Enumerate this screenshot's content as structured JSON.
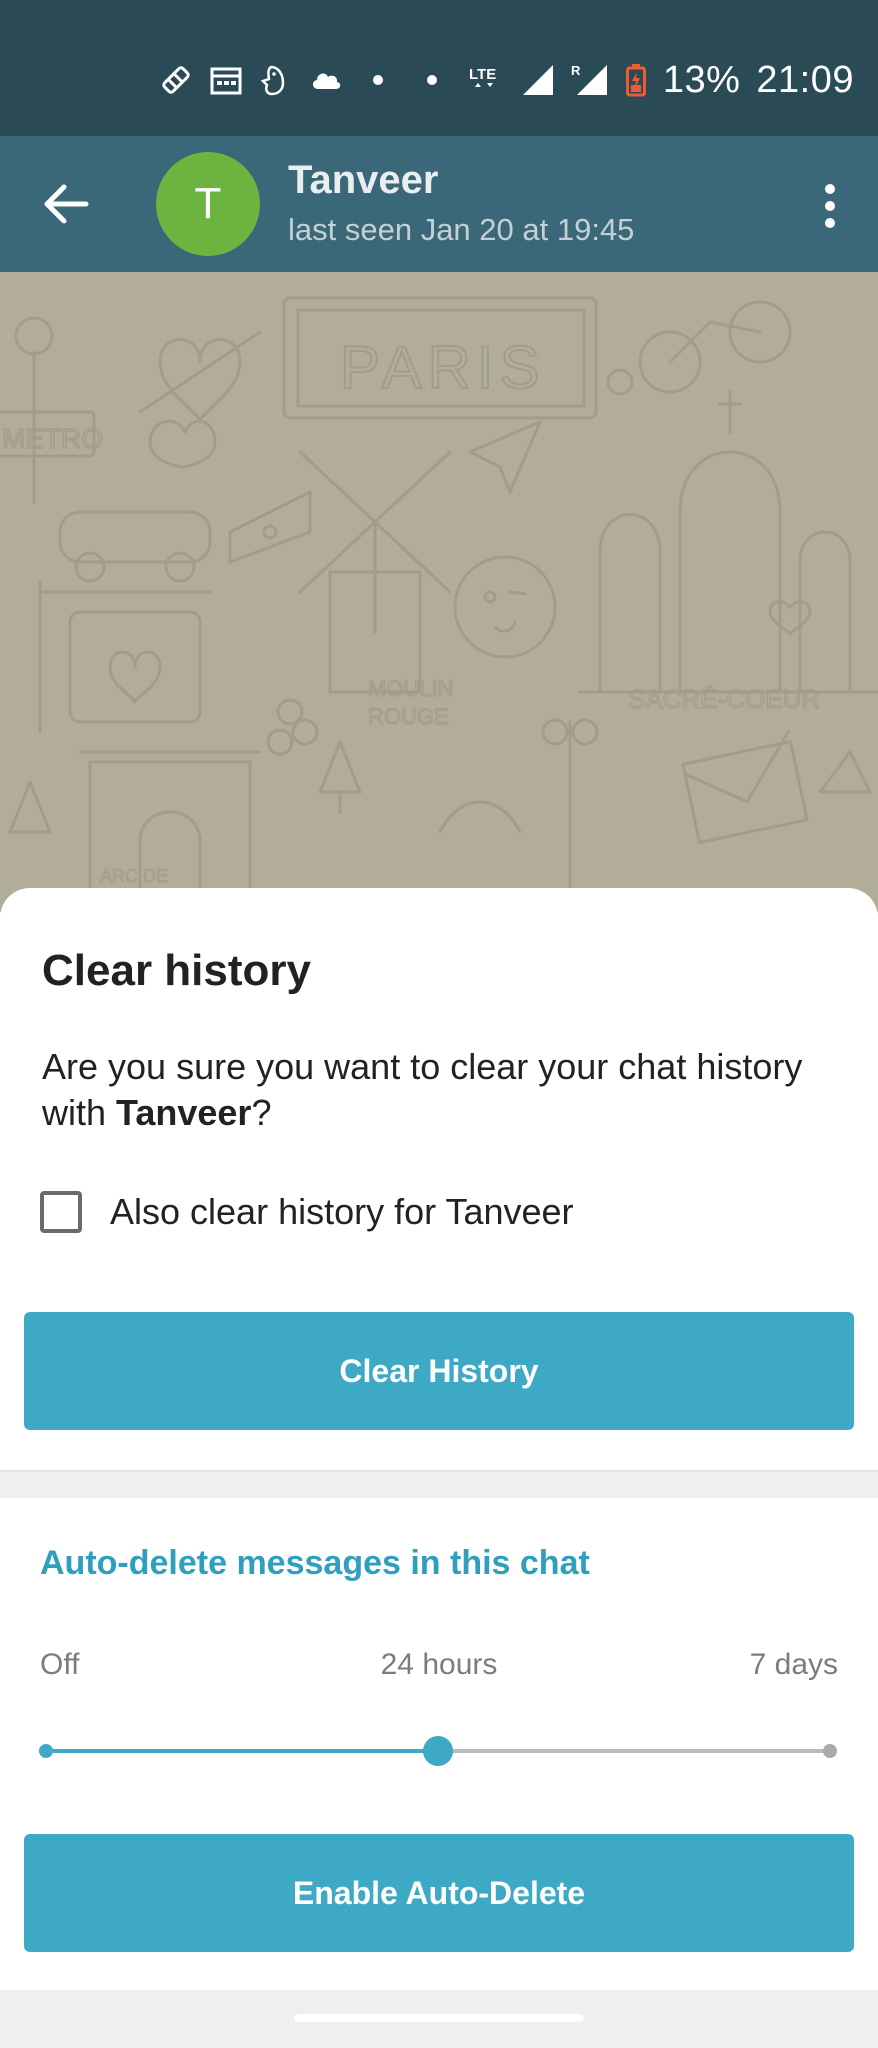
{
  "status_bar": {
    "battery": "13%",
    "time": "21:09",
    "network": "LTE",
    "roaming": "R"
  },
  "app_bar": {
    "avatar_letter": "T",
    "chat_name": "Tanveer",
    "last_seen": "last seen Jan 20 at 19:45"
  },
  "wallpaper": {
    "paris_label": "PARIS",
    "moulin_label_1": "MOULIN",
    "moulin_label_2": "ROUGE",
    "sacre_label": "SACRÉ-COEUR",
    "metro_label": "METRO",
    "arc_label": "ARC DE"
  },
  "dialog": {
    "title": "Clear history",
    "message_prefix": "Are you sure you want to clear your chat history with ",
    "message_name": "Tanveer",
    "message_suffix": "?",
    "checkbox_label": "Also clear history for Tanveer",
    "checkbox_checked": false,
    "clear_button": "Clear History"
  },
  "auto_delete": {
    "title": "Auto-delete messages in this chat",
    "options": [
      "Off",
      "24 hours",
      "7 days"
    ],
    "selected": "24 hours",
    "enable_button": "Enable Auto-Delete"
  },
  "colors": {
    "status_bar": "#2a4a56",
    "app_bar": "#3b6878",
    "accent": "#3ea9c5",
    "avatar": "#6ab43f",
    "wallpaper": "#b1ad98"
  }
}
